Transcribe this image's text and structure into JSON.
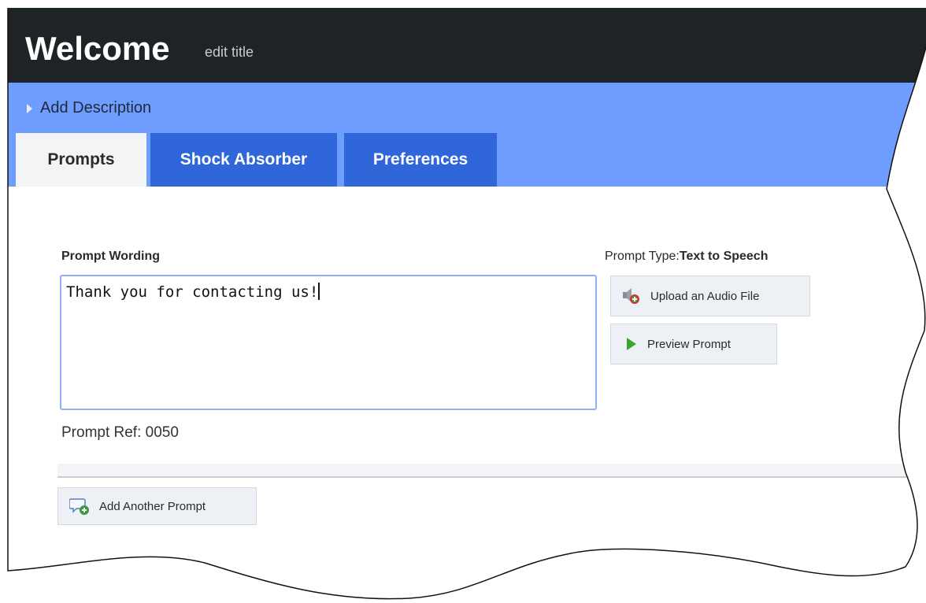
{
  "header": {
    "title": "Welcome",
    "edit_label": "edit title"
  },
  "description": {
    "label": "Add Description"
  },
  "tabs": [
    {
      "label": "Prompts",
      "active": true
    },
    {
      "label": "Shock Absorber",
      "active": false
    },
    {
      "label": "Preferences",
      "active": false
    }
  ],
  "prompt": {
    "wording_label": "Prompt Wording",
    "wording_value": "Thank you for contacting us!",
    "ref_label": "Prompt Ref: 0050",
    "type_label": "Prompt Type:",
    "type_value": "Text to Speech"
  },
  "buttons": {
    "upload": "Upload an Audio File",
    "preview": "Preview Prompt",
    "add_another": "Add Another Prompt"
  },
  "icons": {
    "upload": "speaker-add-icon",
    "preview": "play-icon",
    "add_another": "speech-bubble-add-icon",
    "description": "caret-right-icon"
  },
  "colors": {
    "header_bg": "#1e2326",
    "band_bg": "#6e9cff",
    "tab_inactive": "#2f66d9",
    "tab_active": "#f3f4f6",
    "textarea_border": "#8fb0f2"
  }
}
